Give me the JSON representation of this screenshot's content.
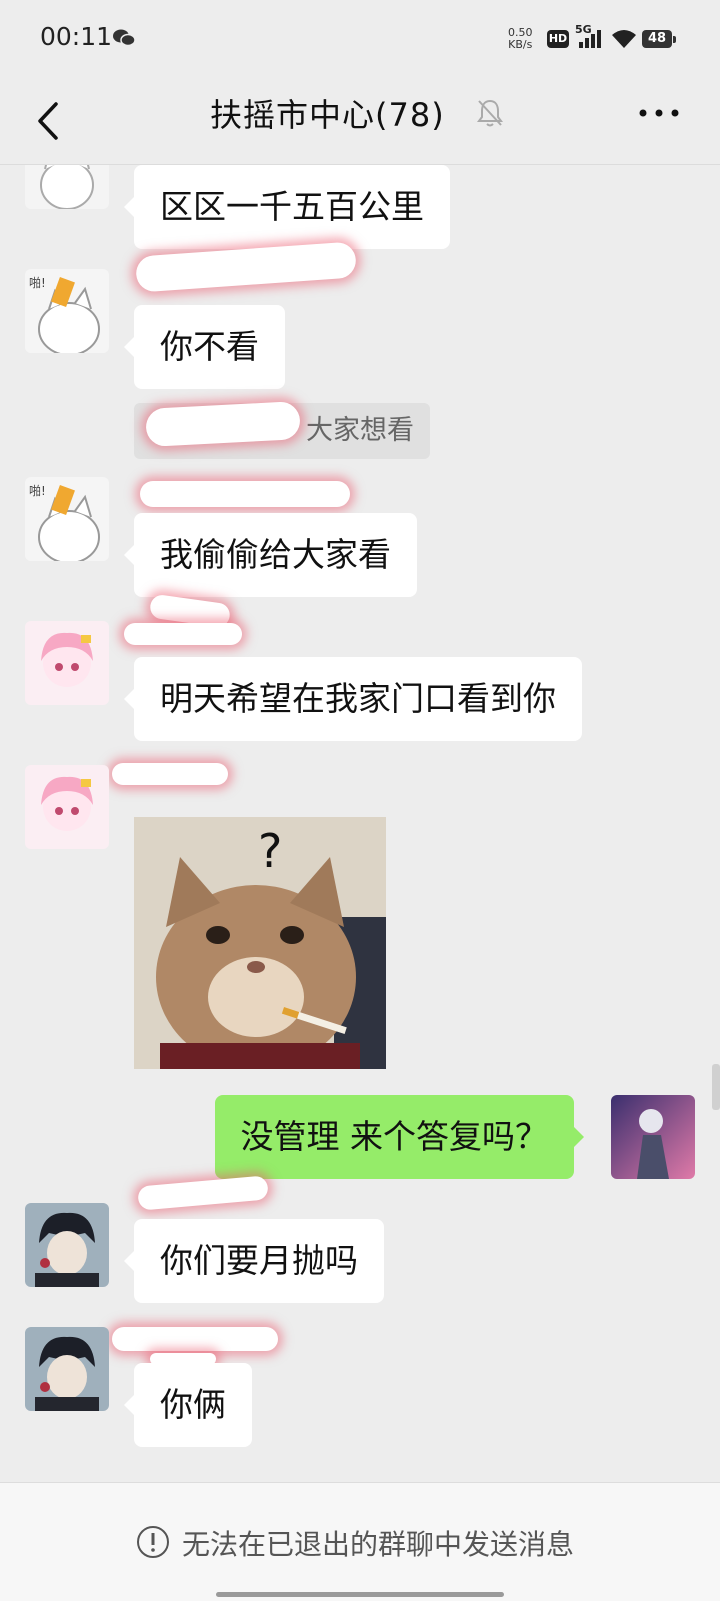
{
  "status_bar": {
    "time": "00:11",
    "net_speed_value": "0.50",
    "net_speed_unit": "KB/s",
    "hd_label": "HD",
    "signal_label": "5G",
    "battery": "48"
  },
  "header": {
    "title": "扶摇市中心(78)"
  },
  "messages": [
    {
      "text": "区区一千五百公里"
    },
    {
      "text": "你不看"
    },
    {
      "text": "我偷偷给大家看"
    },
    {
      "text": "明天希望在我家门口看到你"
    },
    {
      "text": "没管理  来个答复吗？"
    },
    {
      "text": "你们要月抛吗"
    },
    {
      "text": "你俩"
    }
  ],
  "quote": {
    "text": "大家想看"
  },
  "sticker": {
    "mark": "?"
  },
  "footer": {
    "notice": "无法在已退出的群聊中发送消息"
  },
  "colors": {
    "background": "#ededed",
    "incoming_bubble": "#ffffff",
    "outgoing_bubble": "#95ec69"
  }
}
